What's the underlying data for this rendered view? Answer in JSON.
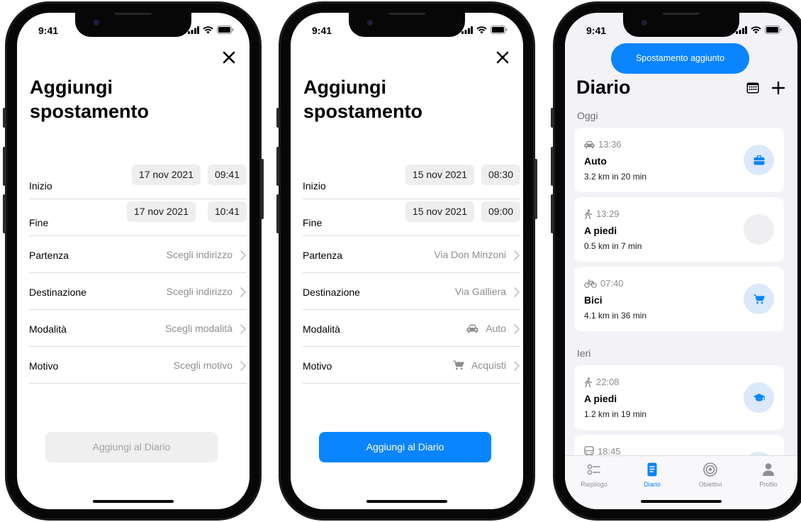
{
  "status_time": "9:41",
  "phones": [
    {
      "title": "Aggiungi spostamento",
      "start_label": "Inizio",
      "start_date": "17 nov 2021",
      "start_time": "09:41",
      "end_label": "Fine",
      "end_date": "17 nov 2021",
      "end_time": "10:41",
      "departure_label": "Partenza",
      "departure_value": "Scegli indirizzo",
      "destination_label": "Destinazione",
      "destination_value": "Scegli indirizzo",
      "mode_label": "Modalità",
      "mode_value": "Scegli modalità",
      "reason_label": "Motivo",
      "reason_value": "Scegli motivo",
      "add_button": "Aggiungi al Diario"
    },
    {
      "title": "Aggiungi spostamento",
      "start_label": "Inizio",
      "start_date": "15 nov 2021",
      "start_time": "08:30",
      "end_label": "Fine",
      "end_date": "15 nov 2021",
      "end_time": "09:00",
      "departure_label": "Partenza",
      "departure_value": "Via Don Minzoni",
      "destination_label": "Destinazione",
      "destination_value": "Via Galliera",
      "mode_label": "Modalità",
      "mode_value": "Auto",
      "mode_icon": "car-icon",
      "reason_label": "Motivo",
      "reason_value": "Acquisti",
      "reason_icon": "cart-icon",
      "add_button": "Aggiungi al Diario"
    }
  ],
  "diary": {
    "toast": "Spostamento aggiunto",
    "title": "Diario",
    "today_label": "Oggi",
    "yesterday_label": "Ieri",
    "trips": [
      {
        "time": "13:36",
        "mode": "Auto",
        "distance": "3.2 km in 20 min",
        "mode_icon": "car-icon",
        "reason_icon": "briefcase-icon"
      },
      {
        "time": "13:29",
        "mode": "A piedi",
        "distance": "0.5 km in 7 min",
        "mode_icon": "walk-icon",
        "reason_icon": ""
      },
      {
        "time": "07:40",
        "mode": "Bici",
        "distance": "4.1 km in 36 min",
        "mode_icon": "bike-icon",
        "reason_icon": "cart-icon"
      },
      {
        "time": "22:08",
        "mode": "A piedi",
        "distance": "1.2 km in 19 min",
        "mode_icon": "walk-icon",
        "reason_icon": "graduation-cap-icon"
      },
      {
        "time": "18:45",
        "mode_icon": "bus-icon"
      }
    ],
    "tabs": [
      {
        "label": "Riepilogo",
        "icon": "list-icon"
      },
      {
        "label": "Diario",
        "icon": "diary-icon",
        "active": true
      },
      {
        "label": "Obiettivi",
        "icon": "target-icon"
      },
      {
        "label": "Profilo",
        "icon": "profile-icon"
      }
    ]
  },
  "colors": {
    "accent": "#0a84ff",
    "badge_bg": "#dbe9fb",
    "disabled_bg": "#efefef"
  }
}
